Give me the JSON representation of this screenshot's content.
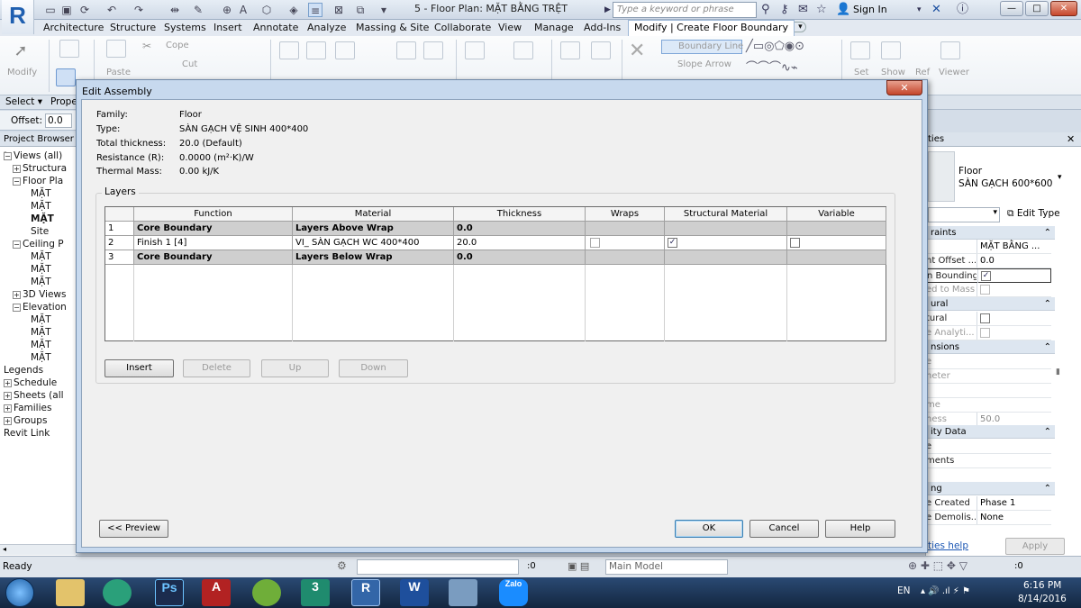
{
  "titlebar": {
    "document_title": "5 - Floor Plan: MẶT BẰNG TRỆT",
    "search_placeholder": "Type a keyword or phrase",
    "sign_in": "Sign In"
  },
  "ribbon_tabs": [
    "Architecture",
    "Structure",
    "Systems",
    "Insert",
    "Annotate",
    "Analyze",
    "Massing & Site",
    "Collaborate",
    "View",
    "Manage",
    "Add-Ins",
    "Modify | Create Floor Boundary"
  ],
  "ribbon": {
    "modify": "Modify",
    "paste": "Paste",
    "cope": "Cope",
    "cut": "Cut",
    "boundary_line": "Boundary Line",
    "slope_arrow": "Slope Arrow",
    "set": "Set",
    "show": "Show",
    "ref": "Ref",
    "viewer": "Viewer"
  },
  "select_row": {
    "select": "Select ▾",
    "properties": "Prope"
  },
  "offset": {
    "label": "Offset:",
    "value": "0.0"
  },
  "project_browser": {
    "title": "Project Browser -",
    "items": [
      {
        "label": "Views (all)",
        "expander": "−"
      },
      {
        "label": "Structura",
        "expander": "+"
      },
      {
        "label": "Floor Pla",
        "expander": "−"
      },
      {
        "label": "MẶT"
      },
      {
        "label": "MẶT"
      },
      {
        "label": "MẶT"
      },
      {
        "label": "Site"
      },
      {
        "label": "Ceiling P",
        "expander": "−"
      },
      {
        "label": "MẶT"
      },
      {
        "label": "MẶT"
      },
      {
        "label": "MẶT"
      },
      {
        "label": "3D Views",
        "expander": "+"
      },
      {
        "label": "Elevation",
        "expander": "−"
      },
      {
        "label": "MẶT"
      },
      {
        "label": "MẶT"
      },
      {
        "label": "MẶT"
      },
      {
        "label": "MẶT"
      },
      {
        "label": "Legends"
      },
      {
        "label": "Schedule",
        "expander": "+"
      },
      {
        "label": "Sheets (all",
        "expander": "+"
      },
      {
        "label": "Families",
        "expander": "+"
      },
      {
        "label": "Groups",
        "expander": "+"
      },
      {
        "label": "Revit Link"
      }
    ]
  },
  "properties": {
    "title": "ties",
    "type_family": "Floor",
    "type_name": "SÀN GẠCH 600*600",
    "edit_type": "Edit Type",
    "sections": {
      "constraints": "raints",
      "structural": "ural",
      "dimensions": "nsions",
      "identity": "ity Data",
      "phasing": "ng"
    },
    "rows": {
      "level_value": "MẶT BẰNG ...",
      "height_offset": "nt Offset ...",
      "height_offset_value": "0.0",
      "room_bounding": "n Bounding",
      "related_mass": "ed to Mass",
      "structural": "tural",
      "analytical": "e Analyti...",
      "slope": "e",
      "perimeter": "neter",
      "area": "",
      "volume": "me",
      "thickness": "ness",
      "thickness_value": "50.0",
      "image": "e",
      "comments": "ments",
      "mark": "",
      "phase_created": "e Created",
      "phase_created_value": "Phase 1",
      "phase_demolished": "e Demolis...",
      "phase_demolished_value": "None"
    },
    "help_link": "ties help",
    "apply": "Apply"
  },
  "statusbar": {
    "ready": "Ready",
    "zero": ":0",
    "model": "Main Model",
    "filter": ":0"
  },
  "taskbar": {
    "lang": "EN",
    "time": "6:16 PM",
    "date": "8/14/2016",
    "zalo": "Zalo"
  },
  "dialog": {
    "title": "Edit Assembly",
    "close": "✕",
    "family_label": "Family:",
    "family": "Floor",
    "type_label": "Type:",
    "type": "SÀN GẠCH VỆ SINH 400*400",
    "thickness_label": "Total thickness:",
    "thickness": "20.0 (Default)",
    "resistance_label": "Resistance (R):",
    "resistance": "0.0000 (m²·K)/W",
    "thermal_label": "Thermal Mass:",
    "thermal": "0.00 kJ/K",
    "layers_title": "Layers",
    "columns": [
      "",
      "Function",
      "Material",
      "Thickness",
      "Wraps",
      "Structural Material",
      "Variable"
    ],
    "rows": [
      {
        "num": "1",
        "function": "Core Boundary",
        "material": "Layers Above Wrap",
        "thickness": "0.0"
      },
      {
        "num": "2",
        "function": "Finish 1 [4]",
        "material": "VI_ SÀN GẠCH WC 400*400",
        "thickness": "20.0"
      },
      {
        "num": "3",
        "function": "Core Boundary",
        "material": "Layers Below Wrap",
        "thickness": "0.0"
      }
    ],
    "insert": "Insert",
    "delete": "Delete",
    "up": "Up",
    "down": "Down",
    "preview": "<< Preview",
    "ok": "OK",
    "cancel": "Cancel",
    "help": "Help"
  }
}
